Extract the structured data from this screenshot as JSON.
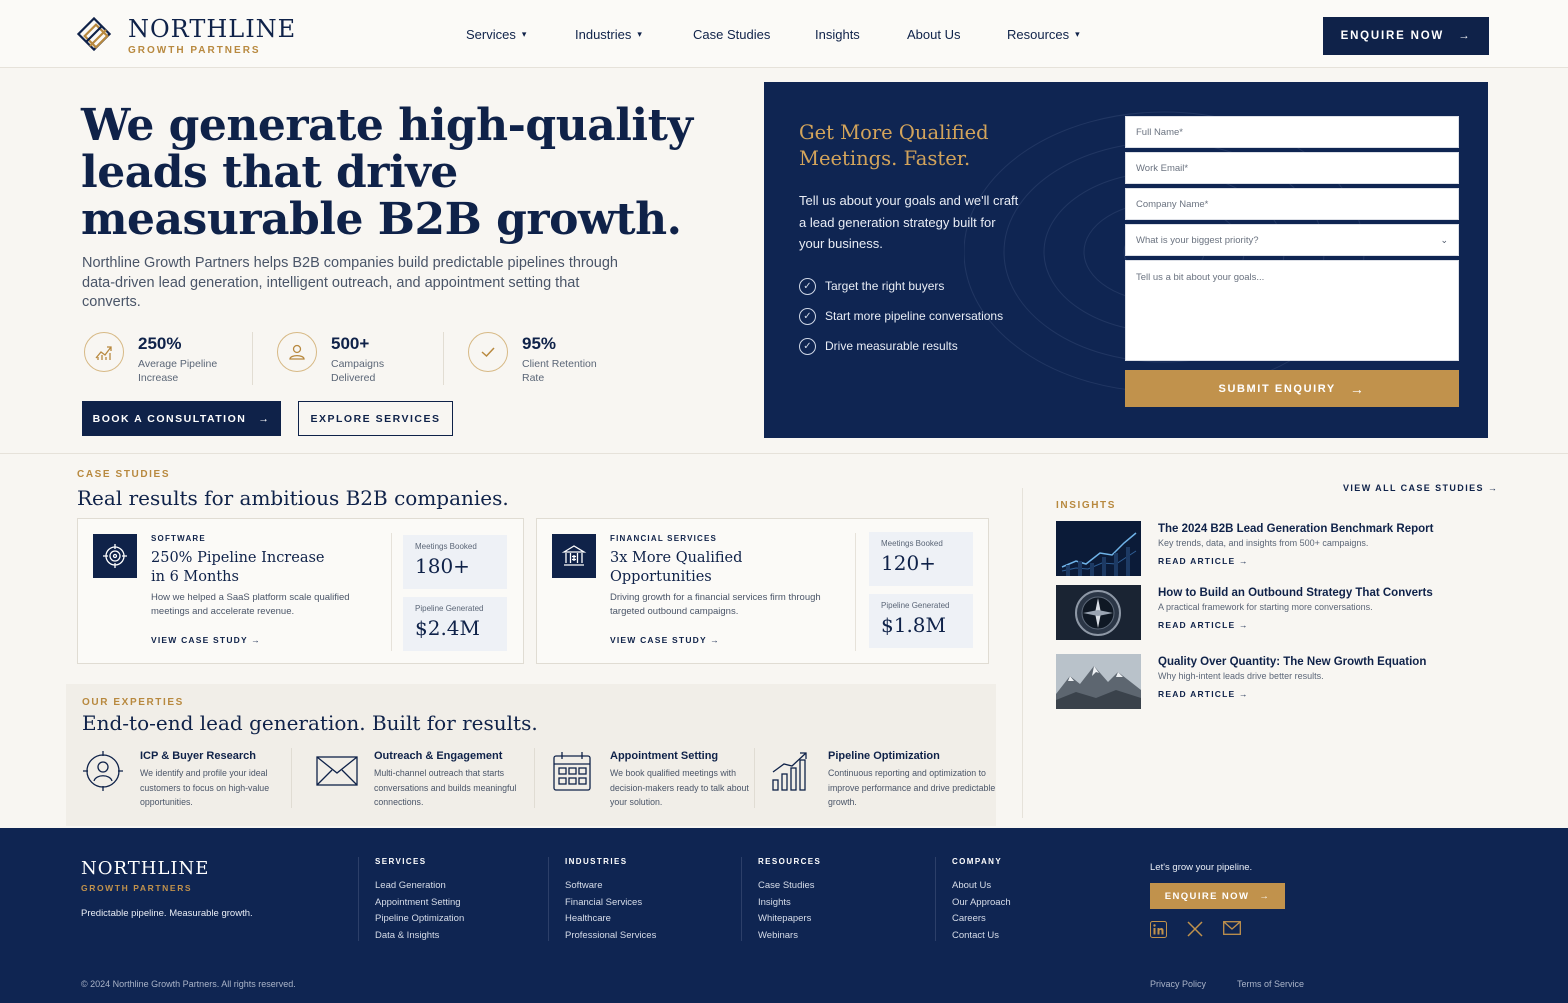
{
  "header": {
    "brand_name": "NORTHLINE",
    "brand_sub": "GROWTH PARTNERS",
    "nav": [
      {
        "label": "Services",
        "dropdown": true
      },
      {
        "label": "Industries",
        "dropdown": true
      },
      {
        "label": "Case Studies",
        "dropdown": false
      },
      {
        "label": "Insights",
        "dropdown": false
      },
      {
        "label": "About Us",
        "dropdown": false
      },
      {
        "label": "Resources",
        "dropdown": true
      }
    ],
    "cta": "ENQUIRE NOW"
  },
  "hero": {
    "title": "We generate high-quality leads that drive measurable B2B growth.",
    "description": "Northline Growth Partners helps B2B companies build predictable pipelines through data-driven lead generation, intelligent outreach, and appointment setting that converts.",
    "stats": [
      {
        "value": "250%",
        "label": "Average Pipeline Increase",
        "icon": "growth-chart-icon"
      },
      {
        "value": "500+",
        "label": "Campaigns Delivered",
        "icon": "user-icon"
      },
      {
        "value": "95%",
        "label": "Client Retention Rate",
        "icon": "check-icon"
      }
    ],
    "primary_cta": "BOOK A CONSULTATION",
    "secondary_cta": "EXPLORE SERVICES"
  },
  "form": {
    "heading": "Get More Qualified Meetings. Faster.",
    "text": "Tell us about your goals and we'll craft a lead generation strategy built for your business.",
    "checks": [
      "Target the right buyers",
      "Start more pipeline conversations",
      "Drive measurable results"
    ],
    "full_name_placeholder": "Full Name*",
    "email_placeholder": "Work Email*",
    "company_placeholder": "Company Name*",
    "priority_placeholder": "What is your biggest priority?",
    "goals_placeholder": "Tell us a bit about your goals...",
    "submit": "SUBMIT ENQUIRY"
  },
  "case_studies": {
    "eyebrow": "CASE STUDIES",
    "title": "Real results for ambitious B2B companies.",
    "view_all": "VIEW ALL CASE STUDIES",
    "cards": [
      {
        "category": "SOFTWARE",
        "title": "250% Pipeline Increase in 6 Months",
        "description": "How we helped a SaaS platform scale qualified meetings and accelerate revenue.",
        "link": "VIEW CASE STUDY",
        "metrics": [
          {
            "label": "Meetings Booked",
            "value": "180+"
          },
          {
            "label": "Pipeline Generated",
            "value": "$2.4M"
          }
        ]
      },
      {
        "category": "FINANCIAL SERVICES",
        "title": "3x More Qualified Opportunities",
        "description": "Driving growth for a financial services firm through targeted outbound campaigns.",
        "link": "VIEW CASE STUDY",
        "metrics": [
          {
            "label": "Meetings Booked",
            "value": "120+"
          },
          {
            "label": "Pipeline Generated",
            "value": "$1.8M"
          }
        ]
      }
    ]
  },
  "expertise": {
    "eyebrow": "OUR EXPERTIES",
    "title": "End-to-end lead generation. Built for results.",
    "items": [
      {
        "title": "ICP & Buyer Research",
        "description": "We identify and profile your ideal customers to focus on high-value opportunities."
      },
      {
        "title": "Outreach & Engagement",
        "description": "Multi-channel outreach that starts conversations and builds meaningful connections."
      },
      {
        "title": "Appointment Setting",
        "description": "We book qualified meetings with decision-makers ready to talk about your solution."
      },
      {
        "title": "Pipeline Optimization",
        "description": "Continuous reporting and optimization to improve performance and drive predictable growth."
      }
    ]
  },
  "insights": {
    "eyebrow": "INSIGHTS",
    "articles": [
      {
        "title": "The 2024 B2B Lead Generation Benchmark Report",
        "summary": "Key trends, data, and insights from 500+ campaigns.",
        "link": "READ ARTICLE"
      },
      {
        "title": "How to Build an Outbound Strategy That Converts",
        "summary": "A practical framework for starting more conversations.",
        "link": "READ ARTICLE"
      },
      {
        "title": "Quality Over Quantity: The New Growth Equation",
        "summary": "Why high-intent leads drive better results.",
        "link": "READ ARTICLE"
      }
    ]
  },
  "footer": {
    "brand_name": "NORTHLINE",
    "brand_sub": "GROWTH PARTNERS",
    "tagline": "Predictable pipeline. Measurable growth.",
    "columns": [
      {
        "heading": "SERVICES",
        "items": [
          "Lead Generation",
          "Appointment Setting",
          "Pipeline Optimization",
          "Data & Insights"
        ]
      },
      {
        "heading": "INDUSTRIES",
        "items": [
          "Software",
          "Financial Services",
          "Healthcare",
          "Professional Services"
        ]
      },
      {
        "heading": "RESOURCES",
        "items": [
          "Case Studies",
          "Insights",
          "Whitepapers",
          "Webinars"
        ]
      },
      {
        "heading": "COMPANY",
        "items": [
          "About Us",
          "Our Approach",
          "Careers",
          "Contact Us"
        ]
      }
    ],
    "grow_text": "Let's grow your pipeline.",
    "cta": "ENQUIRE NOW",
    "social": [
      "linkedin-icon",
      "x-icon",
      "mail-icon"
    ],
    "copyright": "© 2024 Northline Growth Partners. All rights reserved.",
    "privacy": "Privacy Policy",
    "terms": "Terms of Service"
  },
  "colors": {
    "navy": "#0f2249",
    "panel_navy": "#0f2552",
    "gold": "#c1924c",
    "background": "#f8f6f2"
  }
}
